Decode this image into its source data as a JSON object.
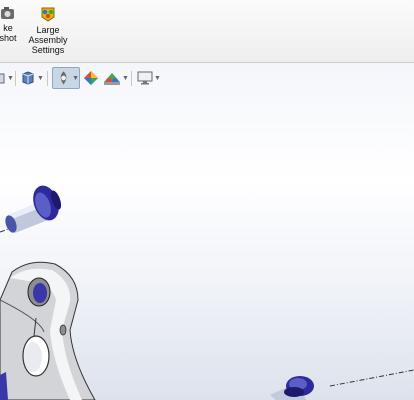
{
  "ribbon": {
    "snapshot_button": {
      "label": "ke\nshot",
      "icon": "camera-icon"
    },
    "large_assembly_button": {
      "label": "Large\nAssembly\nSettings",
      "icon": "large-assembly-icon"
    }
  },
  "view_toolbar": {
    "items": [
      {
        "icon": "view-orientation-icon"
      },
      {
        "icon": "display-style-icon"
      },
      {
        "icon": "hide-show-items-icon"
      },
      {
        "icon": "edit-appearance-icon"
      },
      {
        "icon": "apply-scene-icon"
      },
      {
        "icon": "view-settings-icon"
      }
    ]
  },
  "colors": {
    "ribbon_bg": "#f4f4f4",
    "part_shadow": "#c8c8cc",
    "bushing_blue": "#3a37a8",
    "axis_line": "#333333"
  }
}
